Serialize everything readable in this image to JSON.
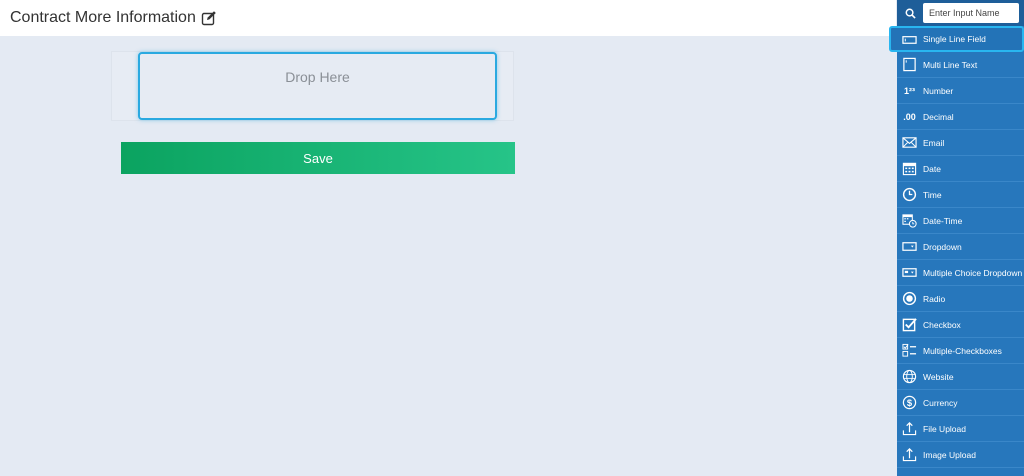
{
  "header": {
    "title": "Contract More Information"
  },
  "canvas": {
    "drop_label": "Drop Here",
    "save_label": "Save"
  },
  "sidebar": {
    "search_placeholder": "Enter Input Name",
    "items": [
      {
        "label": "Single Line Field",
        "icon": "single-line-icon"
      },
      {
        "label": "Multi Line Text",
        "icon": "multi-line-icon"
      },
      {
        "label": "Number",
        "icon": "number-icon"
      },
      {
        "label": "Decimal",
        "icon": "decimal-icon"
      },
      {
        "label": "Email",
        "icon": "envelope-icon"
      },
      {
        "label": "Date",
        "icon": "calendar-icon"
      },
      {
        "label": "Time",
        "icon": "clock-icon"
      },
      {
        "label": "Date-Time",
        "icon": "calendar-clock-icon"
      },
      {
        "label": "Dropdown",
        "icon": "dropdown-icon"
      },
      {
        "label": "Multiple Choice Dropdown",
        "icon": "multi-dropdown-icon"
      },
      {
        "label": "Radio",
        "icon": "radio-icon"
      },
      {
        "label": "Checkbox",
        "icon": "checkbox-icon"
      },
      {
        "label": "Multiple-Checkboxes",
        "icon": "multi-checkbox-icon"
      },
      {
        "label": "Website",
        "icon": "globe-icon"
      },
      {
        "label": "Currency",
        "icon": "dollar-icon"
      },
      {
        "label": "File Upload",
        "icon": "upload-icon"
      },
      {
        "label": "Image Upload",
        "icon": "upload-icon"
      }
    ]
  },
  "colors": {
    "accent": "#2777bc",
    "save_start": "#0ba360",
    "save_end": "#26c488",
    "highlight": "#2aa9e0"
  }
}
